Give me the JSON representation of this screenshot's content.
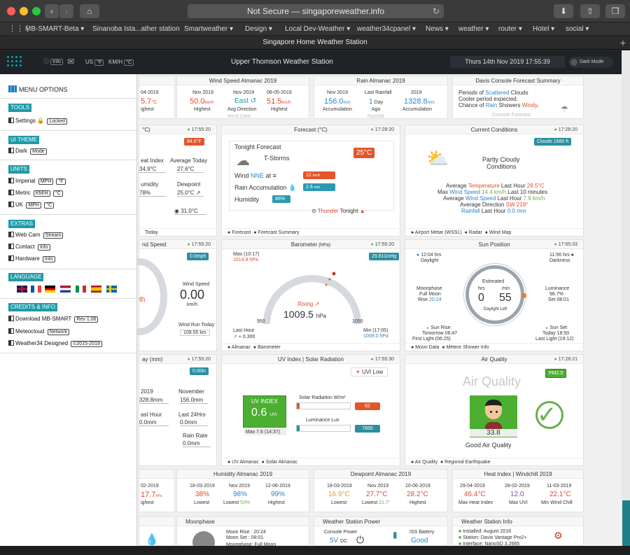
{
  "browser": {
    "url_text": "Not Secure — singaporeweather.info",
    "tab_title": "Singapore Home Weather Station",
    "bookmarks": [
      "MB-SMART-Beta",
      "Sinanoba Ista...ather station",
      "Smartweather",
      "Design",
      "Local Dev-Weather",
      "weather34cpanel",
      "News",
      "weather",
      "router",
      "Hotel",
      "social"
    ]
  },
  "header": {
    "title": "Upper Thomson Weather Station",
    "datetime": "Thurs 14th Nov 2019   17:55:39",
    "dark_mode": "Dark Mode",
    "info": "Info",
    "us": "US",
    "us_unit": "°F",
    "kmh": "KM/H",
    "kmh_unit": "°C"
  },
  "menu": {
    "title": "MENU OPTIONS",
    "tools": "TOOLS",
    "settings": "Settings",
    "locked": "Locked",
    "ui_theme": "UI THEME",
    "dark": "Dark",
    "mode": "Mode",
    "units": "UNITS",
    "imperial": "Imperial",
    "mph": "MPH",
    "degf": "°F",
    "metric": "Metric",
    "kmh": "KM/H",
    "degc": "°C",
    "uk": "UK",
    "mph2": "MPH",
    "degc2": "°C",
    "extras": "EXTRAS",
    "webcam": "Web Cam",
    "stream": "Stream",
    "contact": "Contact",
    "info": "Info",
    "hardware": "Hardware",
    "info2": "Info",
    "language": "LANGUAGE",
    "credits": "CREDITS & INFO",
    "download": "Download MB-SMART",
    "rev": "Rev 1.06",
    "meteocloud": "Meteocloud",
    "network": "Network",
    "designed": "Weather34 Designed",
    "copyright": "©2015-2019"
  },
  "wind_almanac": {
    "title": "Wind Speed Almanac 2019",
    "d1": "Nov 2019",
    "v1": "50.0",
    "u1": "km/h",
    "l1": "Highest",
    "d2": "Nov 2019",
    "v2": "East",
    "l2": "Avg Direction",
    "d3": "08-05-2019",
    "v3": "51.5",
    "u3": "km/h",
    "l3": "Highest",
    "left_d": "04-2019",
    "left_v": "5.7",
    "left_u": "°C",
    "left_l": "ighest",
    "foot": "Wind Data"
  },
  "rain_almanac": {
    "title": "Rain Almanac 2019",
    "d1": "Nov 2019",
    "v1": "156.0",
    "u1": "mm",
    "l1": "Accumulation",
    "d2": "Last Rainfall",
    "v2": "1",
    "u2": "Day",
    "l2": "Ago",
    "d3": "2019",
    "v3": "1328.8",
    "u3": "mm",
    "l3": "Accumulation",
    "foot": "Rainfall"
  },
  "forecast_summary": {
    "title": "Davis Console Forecast Summary",
    "l1a": "Periods of ",
    "l1b": "Scattered",
    "l1c": " Clouds",
    "l2": "Cooler period expected.",
    "l3a": "Chance of ",
    "l3b": "Rain",
    "l3c": " Showers ",
    "l3d": "Windy",
    "foot": "Console Forecast"
  },
  "temp_card": {
    "unit": "°C)",
    "time": "17:55:20",
    "badge": "84.6°F",
    "heat_index": "eat Index",
    "heat_val": "34.9°C",
    "avg_today": "Average Today",
    "avg_val": "27.6°C",
    "humidity": "umidity",
    "hum_val": "78%",
    "dewpoint": "Dewpoint",
    "dew_val": "25.0°C",
    "extra": "31.0°C",
    "foot": "Today"
  },
  "forecast": {
    "title": "Forecast (°C)",
    "time": "17:28:20",
    "tonight": "Tonight Forecast",
    "cond": "T-Storms",
    "temp": "25°C",
    "wind_label": "Wind",
    "wind_dir": "NNE",
    "wind_at": " at",
    "wind_val": "12",
    "wind_unit": "km/h",
    "rain_label": "Rain Accumulation",
    "rain_val": "2.6",
    "rain_unit": "mm",
    "humidity_label": "Humidity",
    "humidity_val": "86%",
    "thunder": "Thunder",
    "tonight2": " Tonight",
    "foot1": "Forecast",
    "foot2": "Forecast Summary"
  },
  "current": {
    "title": "Current Conditions",
    "time": "17:28:20",
    "badge": "Clouds 1680 ft",
    "cond1": "Partly Cloudy",
    "cond2": "Conditions",
    "r1a": "Average ",
    "r1b": "Temperature",
    "r1c": " Last Hour ",
    "r1d": "29.5°C",
    "r2a": "Max ",
    "r2b": "Wind Speed",
    "r2c": " 14.4 km/h",
    "r2d": " Last 10 minutes",
    "r3a": "Average ",
    "r3b": "Wind Speed",
    "r3c": " Last Hour ",
    "r3d": "7.9 km/h",
    "r4a": "Average Direction ",
    "r4b": "SW 219°",
    "r5a": "Rainfall",
    "r5b": " Last Hour ",
    "r5c": "0.0 mm",
    "foot1": "Airport Metar (WSSL)",
    "foot2": "Radar",
    "foot3": "Wind Map"
  },
  "wind_card": {
    "title": "nd Speed",
    "time": "17:55:20",
    "badge": "0.0mph",
    "ws_label": "Wind Speed",
    "ws_val": "0.00",
    "ws_unit": "km/h",
    "run_label": "Wind Run Today",
    "run_val": "109.55 km",
    "th": "th"
  },
  "barometer": {
    "title": "Barometer",
    "unit": " (hPa)",
    "time": "17:55:20",
    "max_label": "Max (10:17)",
    "max_val": "1014.8 hPa",
    "badge": "29.811inHg",
    "trend": "Rising",
    "value": "1009.5",
    "hpa": "hPa",
    "min_scale": "950",
    "max_scale": "1050",
    "last_hour": "Last Hour",
    "last_val": "+ 0.300",
    "min_label": "Min (17:05)",
    "min_val": "1009.0 hPa",
    "foot1": "Almanac",
    "foot2": "Barometer"
  },
  "sun": {
    "title": "Sun Position",
    "time": "17:55:33",
    "daylight_h": "12:04 hrs",
    "daylight": "Daylight",
    "dark_h": "11:56 hrs",
    "darkness": "Darkness",
    "moonphase": "Moonphase",
    "fullmoon": "Full Moon",
    "moonrise": "Rise 20:24",
    "estimated": "Estimated",
    "hrs": "hrs",
    "min": "min",
    "hv": "0",
    "mv": "55",
    "left": "Daylight Left",
    "lum": "Luminance",
    "lum_val": "96.7%",
    "set": "Set 08:01",
    "sunrise": "Sun Rise",
    "tomorrow": "Tomorrow 06:47",
    "first": "First Light (06:25)",
    "sunset": "Sun Set",
    "today": "Today 18:50",
    "last": "Last Light (19:12)",
    "foot1": "Moon Data",
    "foot2": "Meteor Shower Info"
  },
  "rain_card": {
    "title": "ay (mm)",
    "time": "17:55:20",
    "badge": "0.00in",
    "y": "2019",
    "yv": "328.8mm",
    "nov": "November",
    "novv": "156.0mm",
    "lh": "ast Hour",
    "lhv": "0.0mm",
    "l24": "Last 24Hrs",
    "l24v": "0.0mm",
    "rr": "Rain Rate",
    "rrv": "0.0mm"
  },
  "uv": {
    "title": "UV Index | Solar Radiation",
    "time": "17:55:30",
    "uvi_low": "UVI Low",
    "uv_label": "UV INDEX",
    "uv_val": "0.6",
    "uvi": "UVI",
    "max": "Max 7.6 (14:37)",
    "solar_label": "Solar Radiation W/m²",
    "solar_val": "62",
    "solar_frac": 0.05,
    "lux_label": "Luminance Lux",
    "lux_val": "7855",
    "lux_frac": 0.05,
    "foot1": "UV Almanac",
    "foot2": "Solar Almanac"
  },
  "air": {
    "title": "Air Quality",
    "time": "17:28:21",
    "heading": "Air Quality",
    "badge": "PM2.5",
    "val": "33.8",
    "label": "Good Air Quality",
    "foot1": "Air Quality",
    "foot2": "Regional Earthquake"
  },
  "row4": {
    "c0_d": "02-2019",
    "c0_v": "17.7",
    "c0_u": "hPa",
    "c0_l": "ighest",
    "hum_title": "Humidity Almanac 2019",
    "h1d": "18-03-2019",
    "h1v": "38%",
    "h1l": "Lowest",
    "h2d": "Nov 2019",
    "h2v": "98%",
    "h2l": "Lowest ",
    "h2l2": "53%",
    "h3d": "12-06-2019",
    "h3v": "99%",
    "h3l": "Highest",
    "dew_title": "Dewpoint Almanac 2019",
    "d1d": "18-03-2019",
    "d1v": "16.9°C",
    "d1l": "Lowest",
    "d2d": "Nov 2019",
    "d2v": "27.7°C",
    "d2l": "Lowest ",
    "d2l2": "21.7°",
    "d3d": "10-06-2019",
    "d3v": "28.2°C",
    "d3l": "Highest",
    "heat_title": "Heat Index | Windchill 2019",
    "x1d": "29-04-2019",
    "x1v": "46.4°C",
    "x1l": "Max Heat Index",
    "x2d": "28-02-2019",
    "x2v": "12.0",
    "x2l": "Max UVI",
    "x3d": "11-03-2019",
    "x3v": "22.1°C",
    "x3l": "Min Wind Chill"
  },
  "row5": {
    "moon_title": "Moonphase",
    "moonrise": "Moon Rise : 20:24",
    "moonset": "Moon Set :   08:01",
    "phase": "Moonphase: Full Moon",
    "power_title": "Weather Station Power",
    "console": "Console Power",
    "console_v": "5V",
    "dc": "DC",
    "iss": "ISS Battery",
    "iss_v": "Good",
    "info_title": "Weather Station Info",
    "installed": "Installed: August 2018",
    "station": "Station: Davis Vantage Pro2+",
    "interface": "Interface: NanoSD 3.2665"
  }
}
